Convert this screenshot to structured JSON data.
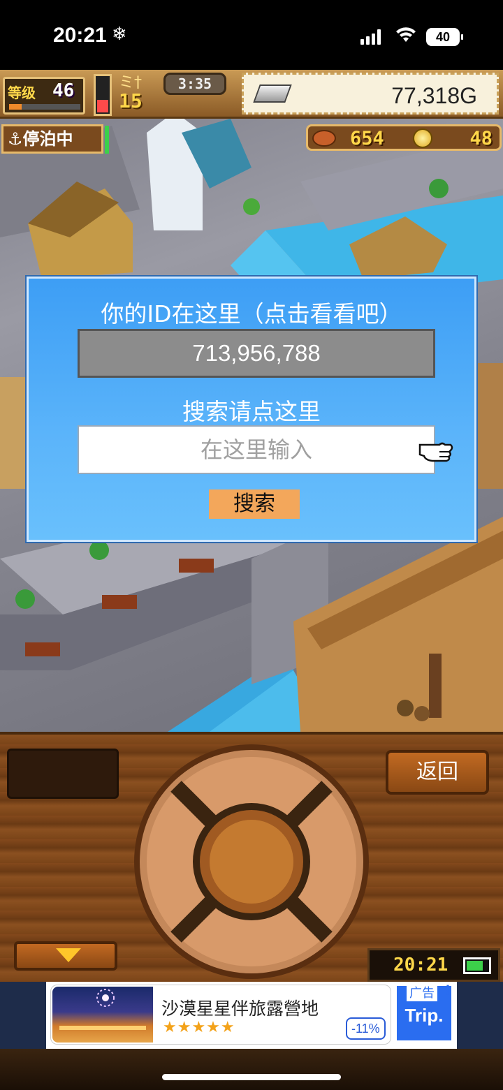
{
  "status_bar": {
    "time": "20:21",
    "snow_icon": "❄",
    "battery": "40",
    "signal_icon": "cellular-signal-icon",
    "wifi_icon": "wifi-icon"
  },
  "hud": {
    "level_label": "等级",
    "level": "46",
    "level_progress": 0.18,
    "stamina_level": 0.35,
    "crew_icon": "ミ†",
    "crew_count": "15",
    "timer": "3:35",
    "gold": "77,318G",
    "docked_label": "⚓停泊中",
    "food": "654",
    "coins": "48"
  },
  "dialog": {
    "title": "你的ID在这里（点击看看吧）",
    "id_value": "713,956,788",
    "search_label": "搜索请点这里",
    "input_placeholder": "在这里输入",
    "search_button": "搜索"
  },
  "controls": {
    "back_button": "返回",
    "clock": "20:21",
    "battery_level": 0.75
  },
  "ad": {
    "title": "沙漠星星伴旅露營地",
    "stars": "★★★★★",
    "discount": "-11%",
    "label": "广告",
    "logo": "Trip.",
    "dots": "⋮"
  },
  "colors": {
    "dialog_bg": "#4aa8f8",
    "search_button": "#f3a75b",
    "hud_gold": "#ffd84a"
  }
}
